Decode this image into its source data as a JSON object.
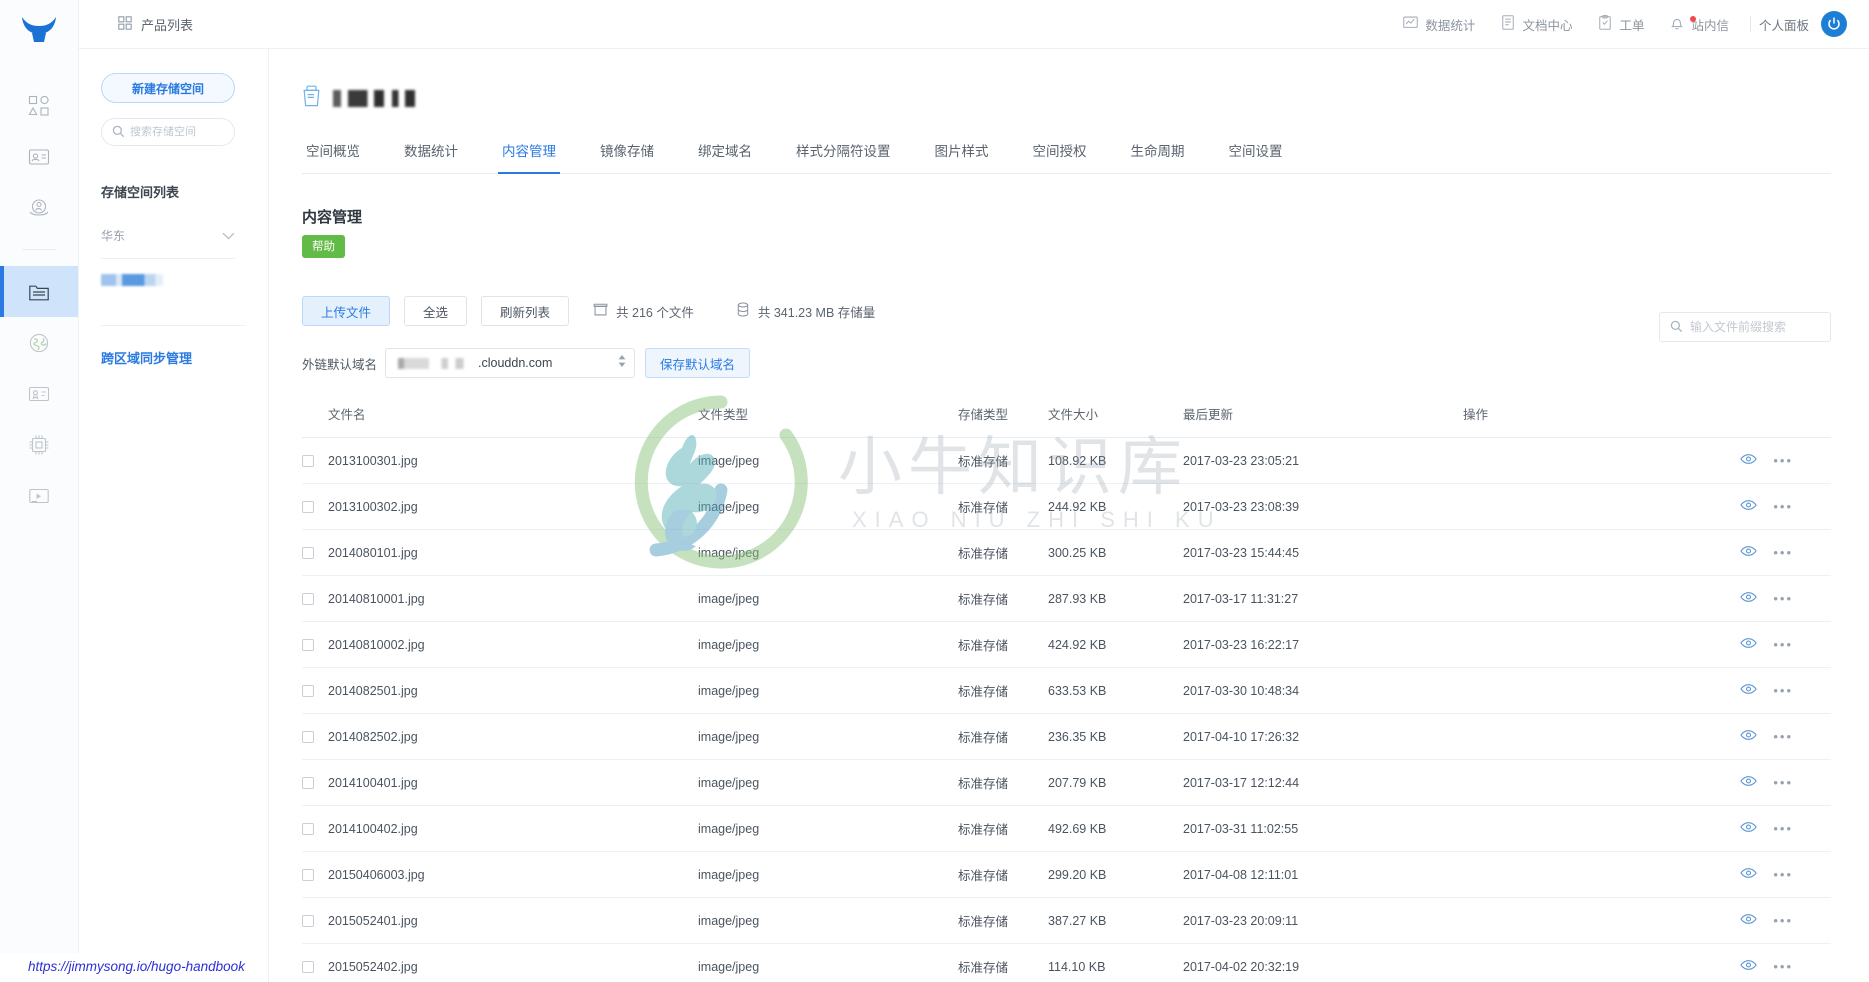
{
  "rail": {
    "logo_icon": "bull-logo-icon",
    "items": [
      {
        "name": "shapes-icon",
        "label": "产品总览"
      },
      {
        "name": "id-card-icon",
        "label": "账号"
      },
      {
        "name": "cloud-user-icon",
        "label": "云用户"
      },
      {
        "name": "storage-folder-icon",
        "label": "对象存储",
        "active": true
      },
      {
        "name": "globe-icon",
        "label": "融合 CDN"
      },
      {
        "name": "certificate-icon",
        "label": "证书管理"
      },
      {
        "name": "chip-icon",
        "label": "智能多媒体"
      },
      {
        "name": "media-icon",
        "label": "直播云"
      }
    ]
  },
  "topbar": {
    "breadcrumb_icon": "grid-icon",
    "breadcrumb": "产品列表",
    "right_items": [
      {
        "icon": "chart-icon",
        "label": "数据统计"
      },
      {
        "icon": "doc-icon",
        "label": "文档中心"
      },
      {
        "icon": "ticket-icon",
        "label": "工单"
      },
      {
        "icon": "bell-icon",
        "label": "站内信",
        "badge": true
      }
    ],
    "user_panel": "个人面板",
    "avatar_icon": "power-avatar-icon"
  },
  "left_panel": {
    "new_bucket_button": "新建存储空间",
    "search_placeholder": "搜索存储空间",
    "search_value": "",
    "search_icon": "search-icon",
    "list_title": "存储空间列表",
    "region": "华东",
    "region_icon": "chevron-down-icon",
    "bucket_redacted": true,
    "cross_region_link": "跨区域同步管理"
  },
  "main": {
    "bucket_icon": "bucket-icon",
    "bucket_name_redacted": true,
    "tabs": [
      {
        "label": "空间概览",
        "active": false
      },
      {
        "label": "数据统计",
        "active": false
      },
      {
        "label": "内容管理",
        "active": true
      },
      {
        "label": "镜像存储",
        "active": false
      },
      {
        "label": "绑定域名",
        "active": false
      },
      {
        "label": "样式分隔符设置",
        "active": false
      },
      {
        "label": "图片样式",
        "active": false
      },
      {
        "label": "空间授权",
        "active": false
      },
      {
        "label": "生命周期",
        "active": false
      },
      {
        "label": "空间设置",
        "active": false
      }
    ],
    "section_title": "内容管理",
    "help_badge": "帮助",
    "toolbar": {
      "upload_button": "上传文件",
      "select_all_button": "全选",
      "refresh_button": "刷新列表",
      "file_count_icon": "box-icon",
      "file_count": "共 216 个文件",
      "storage_icon": "database-icon",
      "storage_total": "共 341.23 MB 存储量"
    },
    "search": {
      "icon": "search-icon",
      "placeholder": "输入文件前缀搜索",
      "value": ""
    },
    "domain": {
      "label": "外链默认域名",
      "select_suffix": ".clouddn.com",
      "select_prefix_redacted": true,
      "spinner_icon": "spinner-updown-icon",
      "save_button": "保存默认域名"
    },
    "table": {
      "columns": [
        "文件名",
        "文件类型",
        "存储类型",
        "文件大小",
        "最后更新",
        "操作"
      ],
      "view_icon": "eye-icon",
      "more_icon": "more-dots-icon",
      "rows": [
        {
          "name": "2013100301.jpg",
          "type": "image/jpeg",
          "storage": "标准存储",
          "size": "108.92 KB",
          "updated": "2017-03-23 23:05:21"
        },
        {
          "name": "2013100302.jpg",
          "type": "image/jpeg",
          "storage": "标准存储",
          "size": "244.92 KB",
          "updated": "2017-03-23 23:08:39"
        },
        {
          "name": "2014080101.jpg",
          "type": "image/jpeg",
          "storage": "标准存储",
          "size": "300.25 KB",
          "updated": "2017-03-23 15:44:45"
        },
        {
          "name": "20140810001.jpg",
          "type": "image/jpeg",
          "storage": "标准存储",
          "size": "287.93 KB",
          "updated": "2017-03-17 11:31:27"
        },
        {
          "name": "20140810002.jpg",
          "type": "image/jpeg",
          "storage": "标准存储",
          "size": "424.92 KB",
          "updated": "2017-03-23 16:22:17"
        },
        {
          "name": "2014082501.jpg",
          "type": "image/jpeg",
          "storage": "标准存储",
          "size": "633.53 KB",
          "updated": "2017-03-30 10:48:34"
        },
        {
          "name": "2014082502.jpg",
          "type": "image/jpeg",
          "storage": "标准存储",
          "size": "236.35 KB",
          "updated": "2017-04-10 17:26:32"
        },
        {
          "name": "2014100401.jpg",
          "type": "image/jpeg",
          "storage": "标准存储",
          "size": "207.79 KB",
          "updated": "2017-03-17 12:12:44"
        },
        {
          "name": "2014100402.jpg",
          "type": "image/jpeg",
          "storage": "标准存储",
          "size": "492.69 KB",
          "updated": "2017-03-31 11:02:55"
        },
        {
          "name": "20150406003.jpg",
          "type": "image/jpeg",
          "storage": "标准存储",
          "size": "299.20 KB",
          "updated": "2017-04-08 12:11:01"
        },
        {
          "name": "2015052401.jpg",
          "type": "image/jpeg",
          "storage": "标准存储",
          "size": "387.27 KB",
          "updated": "2017-03-23 20:09:11"
        },
        {
          "name": "2015052402.jpg",
          "type": "image/jpeg",
          "storage": "标准存储",
          "size": "114.10 KB",
          "updated": "2017-04-02 20:32:19"
        }
      ]
    }
  },
  "watermark": {
    "cn": "小牛知识库",
    "en": "XIAO NIU ZHI SHI KU"
  },
  "status_link": "https://jimmysong.io/hugo-handbook",
  "colors": {
    "accent": "#2a7ae2",
    "help_green": "#62bb46",
    "badge_red": "#f04a4a",
    "text": "#4a545f"
  }
}
